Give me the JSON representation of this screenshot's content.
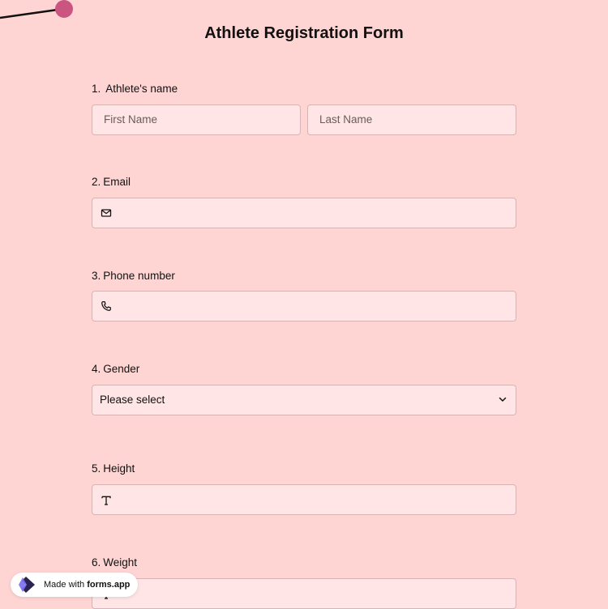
{
  "form": {
    "title": "Athlete Registration Form"
  },
  "questions": [
    {
      "number": "1.",
      "label": "Athlete's name",
      "fields": [
        {
          "placeholder": "First Name"
        },
        {
          "placeholder": "Last Name"
        }
      ]
    },
    {
      "number": "2.",
      "label": "Email",
      "icon": "envelope-icon"
    },
    {
      "number": "3.",
      "label": "Phone number",
      "icon": "phone-icon"
    },
    {
      "number": "4.",
      "label": "Gender",
      "selected": "Please select",
      "icon": "chevron-down-icon"
    },
    {
      "number": "5.",
      "label": "Height",
      "icon": "text-t-icon"
    },
    {
      "number": "6.",
      "label": "Weight",
      "icon": "text-t-icon"
    }
  ],
  "badge": {
    "prefix": "Made with",
    "brand": "forms.app"
  },
  "colors": {
    "background": "#ffd5d4",
    "field_background": "#ffe5e5",
    "field_border": "#d7b3b3",
    "decoration_dot": "#c95580"
  }
}
